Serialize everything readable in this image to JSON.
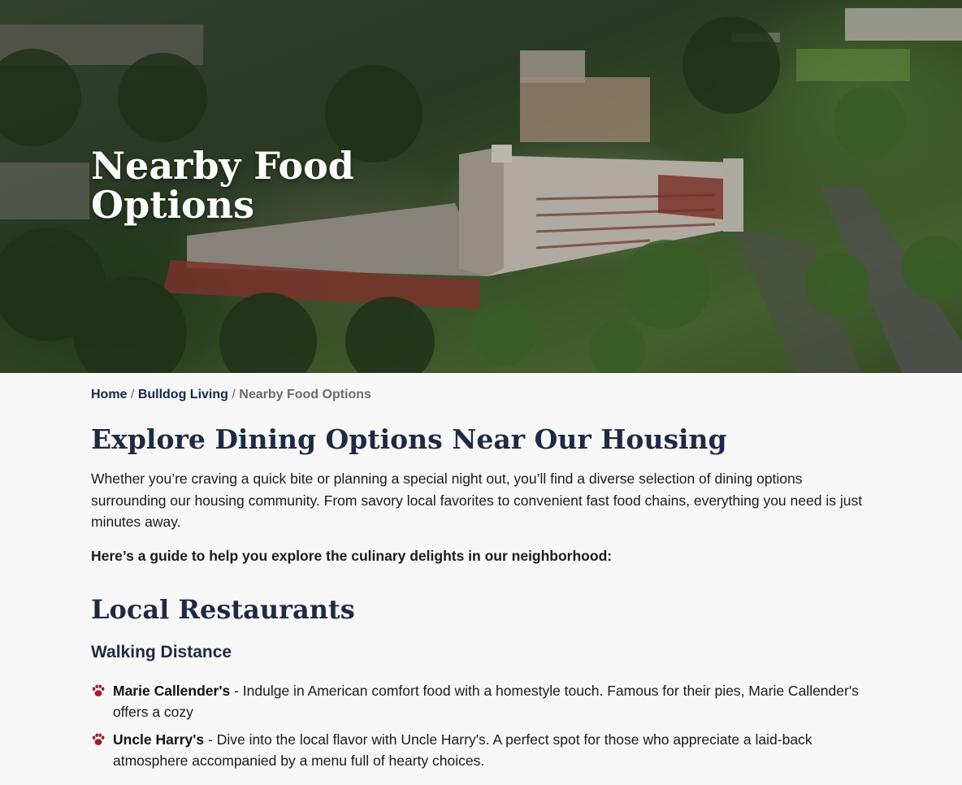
{
  "hero": {
    "title": "Nearby Food Options"
  },
  "breadcrumb": {
    "home": "Home",
    "sep1": "/",
    "parent": "Bulldog Living",
    "sep2": "/",
    "current": "Nearby Food Options"
  },
  "main": {
    "heading": "Explore Dining Options Near Our Housing",
    "intro": "Whether you’re craving a quick bite or planning a special night out, you’ll find a diverse selection of dining options surrounding our housing community. From savory local favorites to convenient fast food chains, everything you need is just minutes away.",
    "guide": "Here’s a guide to help you explore the culinary delights in our neighborhood:",
    "section_heading": "Local Restaurants",
    "sub_heading": "Walking Distance",
    "restaurants": [
      {
        "name": "Marie Callender's",
        "description": " - Indulge in American comfort food with a homestyle touch. Famous for their pies, Marie Callender's offers a cozy"
      },
      {
        "name": "Uncle Harry's",
        "description": " - Dive into the local flavor with Uncle Harry's. A perfect spot for those who appreciate a laid-back atmosphere accompanied by a menu full of hearty choices."
      }
    ]
  },
  "colors": {
    "navy": "#13284c",
    "heading": "#1f2a44",
    "paw": "#a6192e",
    "background": "#f8f8f8"
  },
  "icons": {
    "list_bullet": "paw-icon"
  }
}
